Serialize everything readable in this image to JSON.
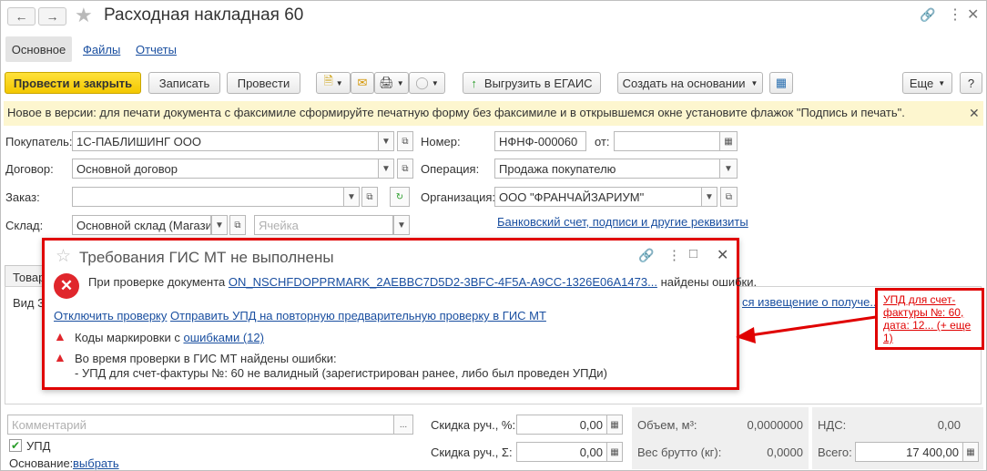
{
  "window": {
    "title": "Расходная накладная 60"
  },
  "tabs": [
    {
      "label": "Основное"
    },
    {
      "label": "Файлы"
    },
    {
      "label": "Отчеты"
    }
  ],
  "toolbar": {
    "post_close": "Провести и закрыть",
    "save": "Записать",
    "post": "Провести",
    "upload": "Выгрузить в ЕГАИС",
    "create_based": "Создать на основании",
    "more": "Еще",
    "help": "?"
  },
  "banner": {
    "text": "Новое в версии: для печати документа с факсимиле сформируйте печатную форму без факсимиле и в открывшемся окне установите флажок \"Подпись и печать\"."
  },
  "form": {
    "buyer_label": "Покупатель:",
    "buyer": "1С-ПАБЛИШИНГ ООО",
    "contract_label": "Договор:",
    "contract": "Основной договор",
    "order_label": "Заказ:",
    "order": "",
    "warehouse_label": "Склад:",
    "warehouse": "Основной склад (Магазин",
    "cell_placeholder": "Ячейка",
    "number_label": "Номер:",
    "number": "НФНФ-000060",
    "from_label": "от:",
    "date": "",
    "operation_label": "Операция:",
    "operation": "Продажа покупателю",
    "org_label": "Организация:",
    "org": "ООО \"ФРАНЧАЙЗАРИУМ\"",
    "bank_link": "Банковский счет, подписи и другие реквизиты"
  },
  "background": {
    "goods_tab": "Товар",
    "kind_label": "Вид З",
    "notice_link": "ся извещение о получе..."
  },
  "dialog": {
    "title": "Требования ГИС МТ не выполнены",
    "msg_prefix": "При проверке документа",
    "doc_link": "ON_NSCHFDOPPRMARK_2AEBBC7D5D2-3BFC-4F5A-A9CC-1326E06A1473...",
    "msg_suffix": "найдены ошибки.",
    "disable_check": "Отключить проверку",
    "resend": "Отправить УПД на повторную предварительную проверку в ГИС МТ",
    "codes_prefix": "Коды маркировки с",
    "codes_link": "ошибками (12)",
    "error_line1": "Во время проверки в ГИС МТ найдены ошибки:",
    "error_line2": "- УПД  для счет-фактуры №: 60  не валидный (зарегистрирован ранее, либо был проведен УПДи)"
  },
  "callout": {
    "text": "УПД  для счет-фактуры №: 60, дата: 12... (+ еще 1)"
  },
  "footer": {
    "comment_placeholder": "Комментарий",
    "upd_label": "УПД",
    "upd_checked": true,
    "basis_label": "Основание:",
    "basis_link": "выбрать",
    "discount_pct_label": "Скидка руч., %:",
    "discount_pct": "0,00",
    "discount_sum_label": "Скидка руч., Σ:",
    "discount_sum": "0,00",
    "volume_label": "Объем, м³:",
    "volume": "0,0000000",
    "gross_label": "Вес брутто (кг):",
    "gross": "0,0000",
    "vat_label": "НДС:",
    "vat": "0,00",
    "total_label": "Всего:",
    "total": "17 400,00"
  },
  "colors": {
    "accent_red": "#e00000",
    "primary_yellow": "#f3c800",
    "link_blue": "#1a4fa0",
    "banner_bg": "#fdf6cf"
  }
}
